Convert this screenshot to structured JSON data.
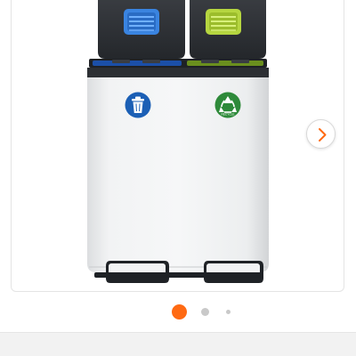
{
  "gallery": {
    "product": "step-bin-dual-compartment",
    "left_compartment_icon": "trash-bin-icon",
    "right_compartment_icon": "recycle-icon",
    "left_label_color": "#1b5fb5",
    "right_label_color": "#2e8a3a",
    "right_label_text": "RECYCLE",
    "left_filter_color": "#3a84e0",
    "right_filter_color": "#b6d640"
  },
  "pager": {
    "icon": "chevron-right-icon",
    "total_pages": 3,
    "active_page": 1,
    "active_color": "#ff6a13",
    "inactive_color": "#c9c9c9"
  },
  "colors": {
    "bin_body": "#eeeff0",
    "lid": "#2c2f33",
    "trim": "#1e2125"
  }
}
